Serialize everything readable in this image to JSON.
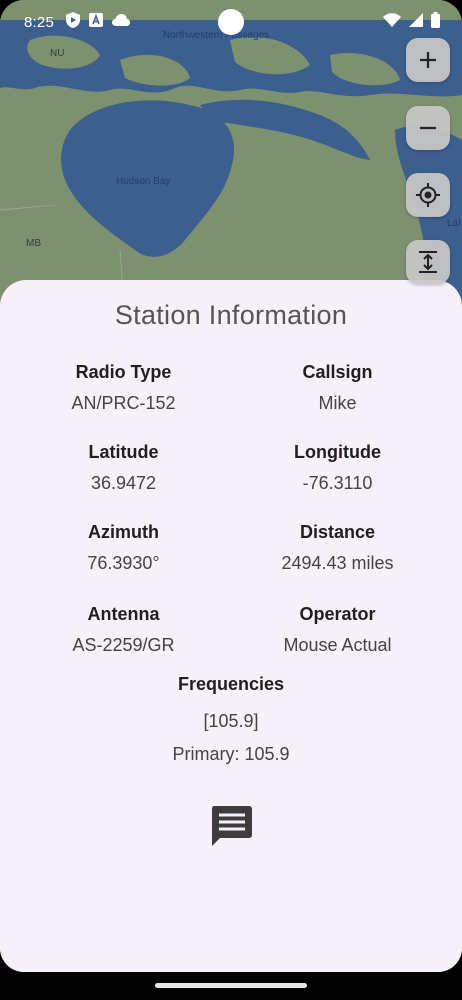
{
  "status_bar": {
    "time": "8:25",
    "left_icons": [
      "play-protect-icon",
      "a-icon",
      "cloud-icon"
    ],
    "right_icons": [
      "wifi-icon",
      "signal-icon",
      "battery-icon"
    ]
  },
  "map": {
    "labels": {
      "northwest_passages": "Northwestern Passages",
      "hudson_bay": "Hudson Bay",
      "nu": "NU",
      "mb": "MB",
      "lab": "Lal"
    },
    "colors": {
      "water": "#3d5f8e",
      "land": "#7d9170"
    }
  },
  "map_controls": {
    "zoom_in": "+",
    "zoom_out": "−",
    "icons": [
      "plus-icon",
      "minus-icon",
      "my-location-icon",
      "fit-bounds-icon"
    ]
  },
  "station": {
    "title": "Station Information",
    "radio_type": {
      "label": "Radio Type",
      "value": "AN/PRC-152"
    },
    "callsign": {
      "label": "Callsign",
      "value": "Mike"
    },
    "latitude": {
      "label": "Latitude",
      "value": "36.9472"
    },
    "longitude": {
      "label": "Longitude",
      "value": "-76.3110"
    },
    "azimuth": {
      "label": "Azimuth",
      "value": "76.3930°"
    },
    "distance": {
      "label": "Distance",
      "value": "2494.43 miles"
    },
    "antenna": {
      "label": "Antenna",
      "value": "AS-2259/GR"
    },
    "operator": {
      "label": "Operator",
      "value": "Mouse Actual"
    },
    "frequencies": {
      "label": "Frequencies",
      "list": "[105.9]",
      "primary": "Primary: 105.9"
    }
  },
  "actions": {
    "message_icon": "message-icon"
  }
}
